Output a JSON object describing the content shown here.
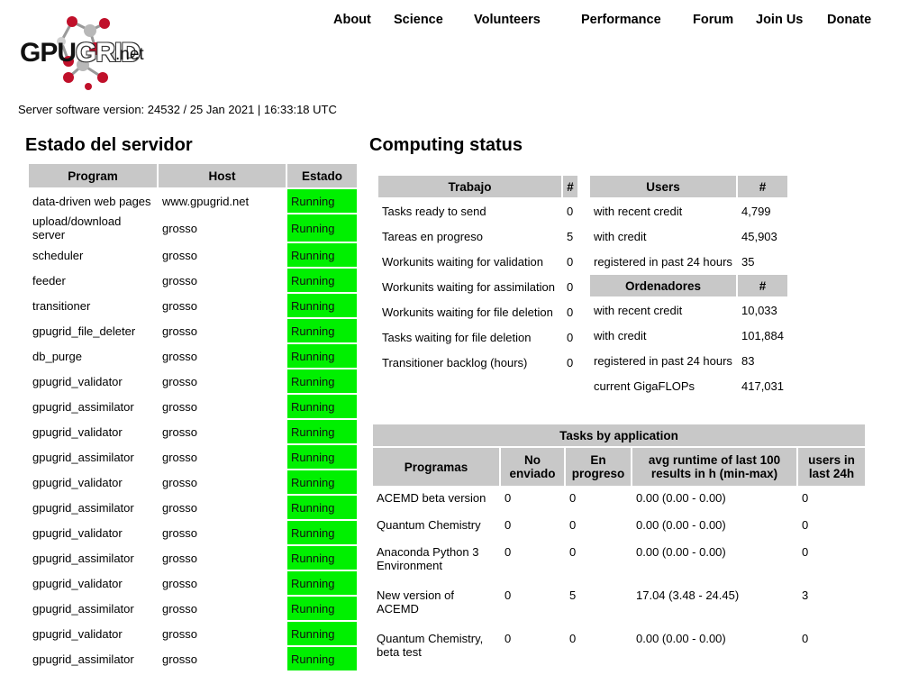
{
  "logo": {
    "gpu": "GPU",
    "grid": "GRID",
    "net": ".net"
  },
  "nav": [
    "About",
    "Science",
    "Volunteers",
    "Performance",
    "Forum",
    "Join Us",
    "Donate"
  ],
  "server_version": "Server software version: 24532 / 25 Jan 2021 | 16:33:18 UTC",
  "server_status": {
    "heading": "Estado del servidor",
    "columns": [
      "Program",
      "Host",
      "Estado"
    ],
    "rows": [
      {
        "program": "data-driven web pages",
        "host": "www.gpugrid.net",
        "status": "Running"
      },
      {
        "program": "upload/download server",
        "host": "grosso",
        "status": "Running"
      },
      {
        "program": "scheduler",
        "host": "grosso",
        "status": "Running"
      },
      {
        "program": "feeder",
        "host": "grosso",
        "status": "Running"
      },
      {
        "program": "transitioner",
        "host": "grosso",
        "status": "Running"
      },
      {
        "program": "gpugrid_file_deleter",
        "host": "grosso",
        "status": "Running"
      },
      {
        "program": "db_purge",
        "host": "grosso",
        "status": "Running"
      },
      {
        "program": "gpugrid_validator",
        "host": "grosso",
        "status": "Running"
      },
      {
        "program": "gpugrid_assimilator",
        "host": "grosso",
        "status": "Running"
      },
      {
        "program": "gpugrid_validator",
        "host": "grosso",
        "status": "Running"
      },
      {
        "program": "gpugrid_assimilator",
        "host": "grosso",
        "status": "Running"
      },
      {
        "program": "gpugrid_validator",
        "host": "grosso",
        "status": "Running"
      },
      {
        "program": "gpugrid_assimilator",
        "host": "grosso",
        "status": "Running"
      },
      {
        "program": "gpugrid_validator",
        "host": "grosso",
        "status": "Running"
      },
      {
        "program": "gpugrid_assimilator",
        "host": "grosso",
        "status": "Running"
      },
      {
        "program": "gpugrid_validator",
        "host": "grosso",
        "status": "Running"
      },
      {
        "program": "gpugrid_assimilator",
        "host": "grosso",
        "status": "Running"
      },
      {
        "program": "gpugrid_validator",
        "host": "grosso",
        "status": "Running"
      },
      {
        "program": "gpugrid_assimilator",
        "host": "grosso",
        "status": "Running"
      }
    ],
    "running_color": "#00f000"
  },
  "computing": {
    "heading": "Computing status",
    "work": {
      "columns": [
        "Trabajo",
        "#"
      ],
      "rows": [
        {
          "label": "Tasks ready to send",
          "value": "0"
        },
        {
          "label": "Tareas en progreso",
          "value": "5"
        },
        {
          "label": "Workunits waiting for validation",
          "value": "0"
        },
        {
          "label": "Workunits waiting for assimilation",
          "value": "0"
        },
        {
          "label": "Workunits waiting for file deletion",
          "value": "0"
        },
        {
          "label": "Tasks waiting for file deletion",
          "value": "0"
        },
        {
          "label": "Transitioner backlog (hours)",
          "value": "0"
        }
      ]
    },
    "users": {
      "columns": [
        "Users",
        "#"
      ],
      "rows": [
        {
          "label": "with recent credit",
          "value": "4,799"
        },
        {
          "label": "with credit",
          "value": "45,903"
        },
        {
          "label": "registered in past 24 hours",
          "value": "35"
        }
      ]
    },
    "computers": {
      "columns": [
        "Ordenadores",
        "#"
      ],
      "rows": [
        {
          "label": "with recent credit",
          "value": "10,033"
        },
        {
          "label": "with credit",
          "value": "101,884"
        },
        {
          "label": "registered in past 24 hours",
          "value": "83"
        },
        {
          "label": "current GigaFLOPs",
          "value": "417,031"
        }
      ]
    },
    "apps": {
      "title": "Tasks by application",
      "columns": [
        "Programas",
        "No enviado",
        "En progreso",
        "avg runtime of last 100 results in h (min-max)",
        "users in last 24h"
      ],
      "rows": [
        {
          "name": "ACEMD beta version",
          "unsent": "0",
          "in_progress": "0",
          "runtime": "0.00 (0.00 - 0.00)",
          "users": "0"
        },
        {
          "name": "Quantum Chemistry",
          "unsent": "0",
          "in_progress": "0",
          "runtime": "0.00 (0.00 - 0.00)",
          "users": "0"
        },
        {
          "name": "Anaconda Python 3 Environment",
          "unsent": "0",
          "in_progress": "0",
          "runtime": "0.00 (0.00 - 0.00)",
          "users": "0"
        },
        {
          "name": "New version of ACEMD",
          "unsent": "0",
          "in_progress": "5",
          "runtime": "17.04 (3.48 - 24.45)",
          "users": "3"
        },
        {
          "name": "Quantum Chemistry, beta test",
          "unsent": "0",
          "in_progress": "0",
          "runtime": "0.00 (0.00 - 0.00)",
          "users": "0"
        }
      ]
    }
  }
}
